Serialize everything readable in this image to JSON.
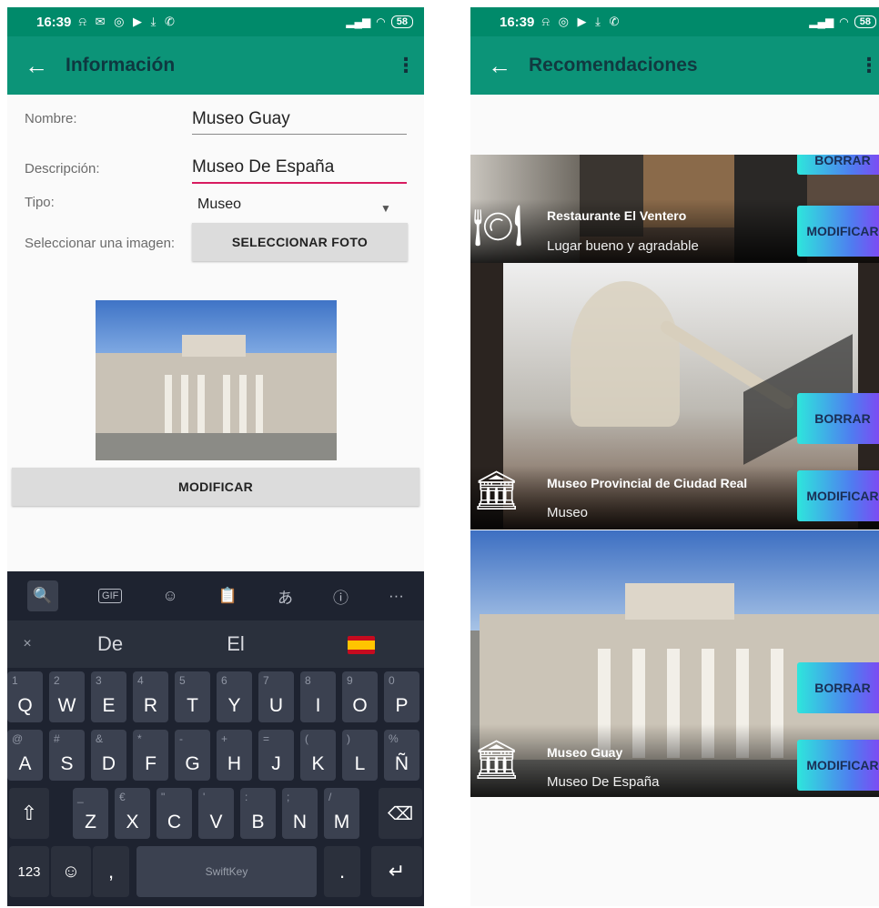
{
  "left_screen": {
    "status": {
      "time": "16:39",
      "icons": "⍾ ✉ ◎ ▶ ⤓ ✆",
      "battery": "58"
    },
    "appbar": {
      "title": "Información",
      "back": "←",
      "menu": "⋮"
    },
    "form": {
      "nombre_label": "Nombre:",
      "nombre_value": "Museo Guay",
      "descripcion_label": "Descripción:",
      "descripcion_value": "Museo De España",
      "tipo_label": "Tipo:",
      "tipo_value": "Museo",
      "imagen_label": "Seleccionar una imagen:",
      "select_photo_button": "SELECCIONAR FOTO",
      "modify_button": "MODIFICAR"
    },
    "keyboard": {
      "tools": [
        "🔍",
        "GIF",
        "☺",
        "📋",
        "あ",
        "ⓘ",
        "···"
      ],
      "close": "×",
      "suggestions": [
        "De",
        "El"
      ],
      "row1": [
        [
          "Q",
          "1"
        ],
        [
          "W",
          "2"
        ],
        [
          "E",
          "3"
        ],
        [
          "R",
          "4"
        ],
        [
          "T",
          "5"
        ],
        [
          "Y",
          "6"
        ],
        [
          "U",
          "7"
        ],
        [
          "I",
          "8"
        ],
        [
          "O",
          "9"
        ],
        [
          "P",
          "0"
        ]
      ],
      "row2": [
        [
          "A",
          "@"
        ],
        [
          "S",
          "#"
        ],
        [
          "D",
          "&"
        ],
        [
          "F",
          "*"
        ],
        [
          "G",
          "-"
        ],
        [
          "H",
          "+"
        ],
        [
          "J",
          "="
        ],
        [
          "K",
          "("
        ],
        [
          "L",
          ")"
        ],
        [
          "Ñ",
          "%"
        ]
      ],
      "row3": [
        [
          "Z",
          "_"
        ],
        [
          "X",
          "€"
        ],
        [
          "C",
          "\""
        ],
        [
          "V",
          "'"
        ],
        [
          "B",
          ":"
        ],
        [
          "N",
          ";"
        ],
        [
          "M",
          "/"
        ]
      ],
      "shift": "⇧",
      "backspace": "⌫",
      "num_key": "123",
      "emoji_key": "☺",
      "comma_key": ",",
      "period_key": ".",
      "space_label": "SwiftKey",
      "enter": "↵"
    }
  },
  "right_screen": {
    "status": {
      "time": "16:39",
      "icons": "⍾ ◎ ▶ ⤓ ✆",
      "battery": "58"
    },
    "appbar": {
      "title": "Recomendaciones",
      "back": "←",
      "menu": "⋮"
    },
    "cards": [
      {
        "title": "Restaurante El Ventero",
        "subtitle": "Lugar bueno y agradable",
        "delete": "BORRAR",
        "modify": "MODIFICAR",
        "icon": "restaurant-icon"
      },
      {
        "title": "Museo Provincial de Ciudad Real",
        "subtitle": "Museo",
        "delete": "BORRAR",
        "modify": "MODIFICAR",
        "icon": "museum-icon"
      },
      {
        "title": "Museo Guay",
        "subtitle": "Museo De España",
        "delete": "BORRAR",
        "modify": "MODIFICAR",
        "icon": "museum-icon"
      }
    ]
  },
  "colors": {
    "status_bar": "#008a6a",
    "app_bar": "#0c9478",
    "accent_underline": "#d81b60",
    "keyboard_bg": "#1e2330"
  }
}
